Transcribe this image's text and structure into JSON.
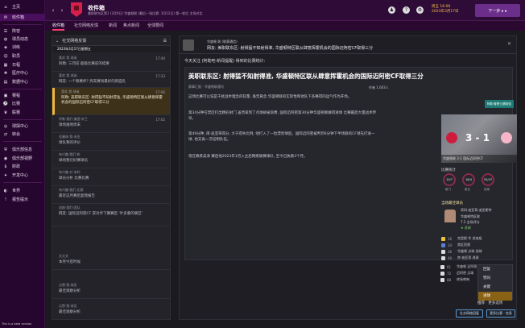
{
  "sidebar": {
    "items": [
      {
        "label": "主页",
        "icon": "home-icon"
      },
      {
        "label": "收件箱",
        "icon": "mail-icon"
      },
      {
        "label": "阵容",
        "icon": "squad-icon"
      },
      {
        "label": "球员动态",
        "icon": "dynamics-icon"
      },
      {
        "label": "训练",
        "icon": "training-icon"
      },
      {
        "label": "职员",
        "icon": "staff-icon"
      },
      {
        "label": "日程",
        "icon": "calendar-icon"
      },
      {
        "label": "医疗中心",
        "icon": "medical-icon"
      },
      {
        "label": "数据中心",
        "icon": "data-icon"
      },
      {
        "label": "赛程",
        "icon": "schedule-icon"
      },
      {
        "label": "比赛",
        "icon": "match-icon"
      },
      {
        "label": "联赛",
        "icon": "league-icon"
      },
      {
        "label": "球探中心",
        "icon": "scout-icon"
      },
      {
        "label": "转会",
        "icon": "transfer-icon"
      },
      {
        "label": "俱乐部信息",
        "icon": "club-info-icon"
      },
      {
        "label": "俱乐部视野",
        "icon": "club-vision-icon"
      },
      {
        "label": "财政",
        "icon": "finance-icon"
      },
      {
        "label": "开发中心",
        "icon": "dev-icon"
      },
      {
        "label": "世界",
        "icon": "globe-icon"
      },
      {
        "label": "报告提示",
        "icon": "report-icon"
      }
    ]
  },
  "topbar": {
    "title": "收件箱",
    "subtitle": "美职联东区第1 (3月9日) 华盛顿联 (最后一场比赛: 3月12日) 第一轮后 主场对比",
    "date_line1": "周五 16:00",
    "date_line2": "2023年3月17日",
    "continue_label": "下一步 ▸ ▸"
  },
  "tabs": [
    "收件箱",
    "社交网络反馈",
    "新闻",
    "焦点新闻",
    "全球要闻"
  ],
  "inbox": {
    "header": "社交网络反馈",
    "date_label": "2023年3月17日星期五",
    "messages": [
      {
        "sender": "喜欢 我 球迷",
        "subject": "阿勒: 三罚前·超级比赛前的结果",
        "time": "17:40"
      },
      {
        "sender": "喜欢 我 球迷",
        "subject": "网友: 一个联赛杯? 周末赛场最好的新面孔",
        "time": "17:33"
      },
      {
        "sender": "喜欢 我 球迷",
        "subject": "阿勒: 美职联东区: 射得猛不知射得准, 华盛顿特区联从肆意挥霍机会的国际迈阿密CF取得三分",
        "time": "17:06"
      },
      {
        "sender": "阿勒·我们·美国·米兰",
        "subject": "球场遍地周末",
        "time": "17:02"
      },
      {
        "sender": "花圃球·我·米亚",
        "subject": "球队我的评价",
        "time": ""
      },
      {
        "sender": "有兴趣·我们·和",
        "subject": "球场我们好赛球员",
        "time": ""
      },
      {
        "sender": "有兴趣 对 米利",
        "subject": "球员分析 比赛比赛",
        "time": ""
      },
      {
        "sender": "有兴趣·我们·比赛",
        "subject": "最近这月赛后复我报告",
        "time": ""
      },
      {
        "sender": "战报·我们·团队",
        "subject": "网友: 国际迈阿密CF 获对手下赛赛区·'叶多重的联区'",
        "time": ""
      },
      {
        "sender": "文文文",
        "subject": "本月今后时候",
        "time": ""
      },
      {
        "sender": "点赞·我·球员",
        "subject": "最佳观察分析",
        "time": ""
      },
      {
        "sender": "点赞·我·球员",
        "subject": "最佳观察分析",
        "time": ""
      }
    ]
  },
  "article": {
    "from": "华盛顿 联 (联赛通信)",
    "re_line": "网友: 美职联东区: 射得猛不知射得准, 华盛顿特区联从肆意挥霍机会的国际迈阿密CF取得三分",
    "intro": "今天关注 (阿勒吧·新闻提醒) 得到的比赛统计:",
    "headline": "美职联东区: 射得猛不知射得准, 华盛顿特区联从肆意挥霍机会的国际迈阿密CF取得三分",
    "source": "赛事汇报 · 华盛顿联通讯",
    "source_info": "作者 1,603人",
    "paragraphs": [
      "这场比赛可以说是干扰战术理念的较量, 毫无悬念 华盛顿联的实际性和他队下多赛得的运气作为开场。",
      "第34分钟在禁区打出精彩射门 虽然拿到了点球却被浪费, 国际迈阿密第30分钟华盛顿联做得进球 比赛最后大量战术传导。",
      "第49分钟, 库·迪亚哥得分, 大于得失比例, 他打入了一粒漂亮球后。国际迈阿密被判罚6分钟下半场联的CF领先打进一球, 他又再一次证明队伍。",
      "现在教练美泽 赛后他2023年1月入主后网络联赛球队, 至今已执教3个月。"
    ],
    "teal_button": "阿勒·管理·比赛报告",
    "match": {
      "home_score": "3",
      "away_score": "1",
      "label": "华盛顿联 3-1 国际迈阿密CF"
    },
    "stats": {
      "title": "比赛统计",
      "gauges": [
        {
          "value": "10/7",
          "label": "射门"
        },
        {
          "value": "16/4",
          "label": "射正"
        },
        {
          "value": "53/47",
          "label": "控球"
        }
      ]
    },
    "player": {
      "title": "当场最佳球员",
      "name": "奇科·迪亚哥·迪亚斯特",
      "club": "华盛顿特区联",
      "role": "7.2 全场评分",
      "rating": "★ 进球"
    },
    "events": [
      {
        "min": "16",
        "text": "克里斯·华 进攻组"
      },
      {
        "min": "34",
        "text": "禁区犯规"
      },
      {
        "min": "36",
        "text": "华盛顿 点球 进球"
      },
      {
        "min": "49",
        "text": "库·迪亚哥 进球"
      },
      {
        "min": "61",
        "text": "华盛顿 迈阿密"
      },
      {
        "min": "72",
        "text": "迈阿密 点球"
      },
      {
        "min": "88",
        "text": "终场哨响"
      }
    ]
  },
  "dropdown": {
    "items": [
      "回复",
      "赞同",
      "关键",
      "进球"
    ],
    "selected_index": 3,
    "trigger": "推荐 · 更多选项"
  },
  "actions": {
    "reply_label": "社交网络回复",
    "more_label": "更多比赛 · 信息"
  },
  "footer": "This is a beta version"
}
